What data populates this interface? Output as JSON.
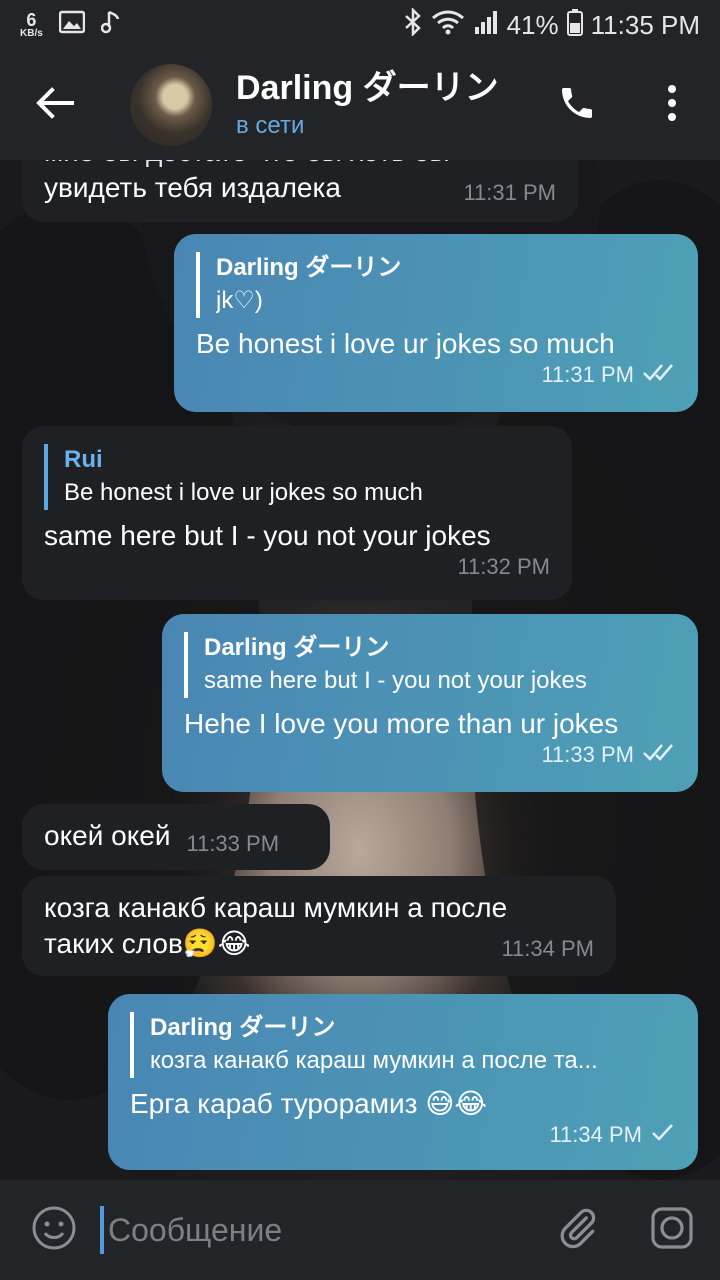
{
  "status_bar": {
    "net_speed_value": "6",
    "net_speed_unit": "KB/s",
    "battery": "41%",
    "time": "11:35 PM"
  },
  "header": {
    "title": "Darling ダーリン",
    "status": "в сети"
  },
  "messages": [
    {
      "dir": "in",
      "text_top": "мне бы достато что бы хоть бы",
      "text": "увидеть тебя издалека",
      "time": "11:31 PM"
    },
    {
      "dir": "out",
      "reply_name": "Darling ダーリン",
      "reply_text": "jk♡)",
      "text": "Be honest i love ur jokes so much",
      "time": "11:31 PM"
    },
    {
      "dir": "in",
      "reply_name": "Rui",
      "reply_text": "Be honest i love ur jokes so much",
      "text": "same here but I - you not your jokes",
      "time": "11:32 PM"
    },
    {
      "dir": "out",
      "reply_name": "Darling ダーリン",
      "reply_text": "same here but I - you not your jokes",
      "text": "Hehe I love you more than ur jokes",
      "time": "11:33 PM"
    },
    {
      "dir": "in",
      "text": "окей окей",
      "time": "11:33 PM"
    },
    {
      "dir": "in",
      "text_line1": "козга канакб караш мумкин а после",
      "text_line2": "таких слов😮‍💨😂",
      "time": "11:34 PM"
    },
    {
      "dir": "out",
      "reply_name": "Darling ダーリン",
      "reply_text": "козга канакб караш мумкин а после та...",
      "text": "Ерга караб турорамиз 😅😂",
      "time": "11:34 PM"
    }
  ],
  "input": {
    "placeholder": "Сообщение"
  },
  "colors": {
    "accent": "#66a9e0",
    "outgoing_bubble": "#4a86b4",
    "incoming_bubble": "#1e2023",
    "bar": "#232428"
  },
  "icons": [
    "back-arrow-icon",
    "phone-icon",
    "more-vertical-icon",
    "emoji-icon",
    "attach-icon",
    "camera-icon",
    "bluetooth-icon",
    "wifi-icon",
    "signal-icon",
    "battery-icon",
    "image-icon",
    "music-note-icon",
    "double-check-icon",
    "single-check-icon"
  ]
}
